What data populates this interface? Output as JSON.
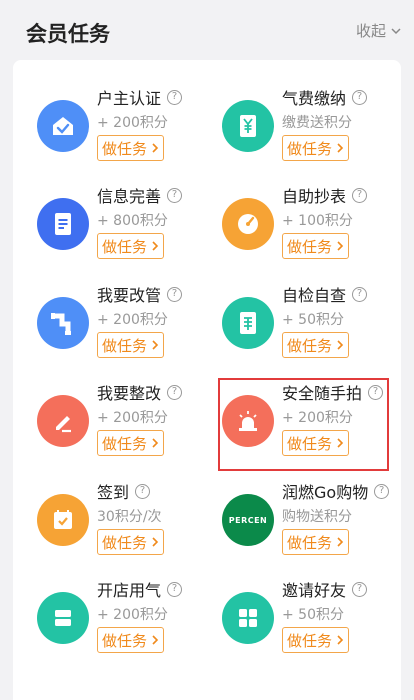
{
  "header": {
    "title": "会员任务",
    "collapse_label": "收起"
  },
  "help_glyph": "?",
  "tasks": [
    {
      "name": "户主认证",
      "points": "+ 200积分",
      "button": "做任务",
      "icon": "house-check-icon",
      "color": "#4f8ff7"
    },
    {
      "name": "气费缴纳",
      "points": "缴费送积分",
      "button": "做任务",
      "icon": "yen-bill-icon",
      "color": "#23c3a4"
    },
    {
      "name": "信息完善",
      "points": "+ 800积分",
      "button": "做任务",
      "icon": "document-icon",
      "color": "#3f6ff0"
    },
    {
      "name": "自助抄表",
      "points": "+ 100积分",
      "button": "做任务",
      "icon": "gauge-icon",
      "color": "#f6a335"
    },
    {
      "name": "我要改管",
      "points": "+ 200积分",
      "button": "做任务",
      "icon": "pipe-icon",
      "color": "#4f8ff7"
    },
    {
      "name": "自检自查",
      "points": "+ 50积分",
      "button": "做任务",
      "icon": "inspect-doc-icon",
      "color": "#23c3a4"
    },
    {
      "name": "我要整改",
      "points": "+ 200积分",
      "button": "做任务",
      "icon": "pencil-icon",
      "color": "#f46f5b"
    },
    {
      "name": "安全随手拍",
      "points": "+ 200积分",
      "button": "做任务",
      "icon": "alarm-light-icon",
      "color": "#f46f5b"
    },
    {
      "name": "签到",
      "points": "30积分/次",
      "button": "做任务",
      "icon": "calendar-check-icon",
      "color": "#f6a335"
    },
    {
      "name": "润燃Go购物",
      "points": "购物送积分",
      "button": "做任务",
      "icon": "percen-logo",
      "color": "#0b8a4a",
      "logo_text": "PERCEN"
    },
    {
      "name": "开店用气",
      "points": "+ 200积分",
      "button": "做任务",
      "icon": "shop-icon",
      "color": "#23c3a4"
    },
    {
      "name": "邀请好友",
      "points": "+ 50积分",
      "button": "做任务",
      "icon": "apps-icon",
      "color": "#23c3a4"
    }
  ]
}
